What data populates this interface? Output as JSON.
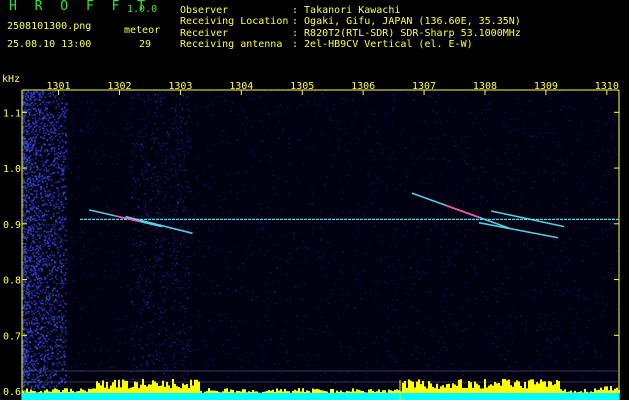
{
  "header": {
    "app_name": "H R O F F T",
    "version": "1.0.0",
    "filename": "2508101300.png",
    "datetime": "25.08.10 13:00",
    "meteor_label": "meteor",
    "meteor_count": "29",
    "info_labels": [
      "Observer",
      "Receiving Location",
      "Receiver",
      "Receiving antenna"
    ],
    "info_values": [
      ": Takanori Kawachi",
      ": Ogaki, Gifu, JAPAN (136.60E, 35.35N)",
      ": R820T2(RTL-SDR) SDR-Sharp 53.1000MHz",
      ": 2el-HB9CV Vertical (el. E-W)"
    ]
  },
  "colors": {
    "header_green": "#2ee62e",
    "header_yellow": "#ffff3a",
    "axis_text": "#ffff3a",
    "noise_blue": "#1a1a8c",
    "carrier": "#4fd9e8",
    "meteor": "#5fe3f0",
    "meteor_core": "#ff4fb4",
    "histogram_yellow": "#ffff00",
    "histogram_cyan": "#00ffff"
  },
  "chart_data": {
    "type": "heatmap",
    "title": "",
    "ylabel": "kHz",
    "xlabel": "",
    "x_ticks": [
      "1301",
      "1302",
      "1303",
      "1304",
      "1305",
      "1306",
      "1307",
      "1308",
      "1309",
      "1310"
    ],
    "y_ticks": [
      "1.1",
      "1.0",
      "0.9",
      "0.8",
      "0.7",
      "0.6"
    ],
    "xlim": [
      1300.4,
      1310.2
    ],
    "ylim": [
      0.584,
      1.14
    ],
    "carrier_khz": 0.908,
    "meteor_traces": [
      {
        "x0": 1301.5,
        "y0": 0.925,
        "x1": 1302.7,
        "y1": 0.895,
        "core": true
      },
      {
        "x0": 1302.1,
        "y0": 0.913,
        "x1": 1303.2,
        "y1": 0.883,
        "core": false
      },
      {
        "x0": 1306.8,
        "y0": 0.955,
        "x1": 1308.4,
        "y1": 0.892,
        "core": true
      },
      {
        "x0": 1308.1,
        "y0": 0.923,
        "x1": 1309.3,
        "y1": 0.895,
        "core": false
      },
      {
        "x0": 1307.9,
        "y0": 0.902,
        "x1": 1309.2,
        "y1": 0.875,
        "core": false
      }
    ]
  }
}
